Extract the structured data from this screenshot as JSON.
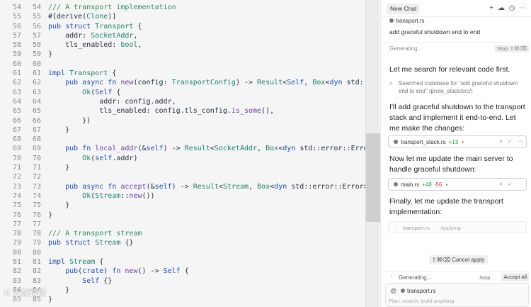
{
  "colors": {
    "comment": "#2f8f57",
    "keyword": "#1d4fb5",
    "type": "#18856f",
    "function": "#6b3fa0",
    "plain": "#1f2d3d",
    "added": "#2e9b4f",
    "removed": "#d24242"
  },
  "editor": {
    "line_numbers_left": [
      "54",
      "55",
      "56",
      "57",
      "58",
      "59",
      "60",
      "61",
      "62",
      "63",
      "64",
      "65",
      "66",
      "67",
      "68",
      "69",
      "70",
      "71",
      "72",
      "73",
      "74",
      "75",
      "76",
      "77",
      "78",
      "79",
      "80",
      "81",
      "82",
      "83",
      "84",
      "85"
    ],
    "line_numbers_right": [
      "54",
      "55",
      "56",
      "57",
      "58",
      "59",
      "60",
      "61",
      "62",
      "63",
      "64",
      "65",
      "66",
      "67",
      "68",
      "69",
      "70",
      "71",
      "72",
      "73",
      "74",
      "75",
      "76",
      "77",
      "78",
      "79",
      "80",
      "81",
      "82",
      "83",
      "84",
      "85"
    ],
    "lines": [
      [
        [
          "cm",
          "/// A transport implementation"
        ]
      ],
      [
        [
          "pl",
          "#[derive("
        ],
        [
          "ty",
          "Clone"
        ],
        [
          "pl",
          ")]"
        ]
      ],
      [
        [
          "kw",
          "pub struct "
        ],
        [
          "ty",
          "Transport"
        ],
        [
          "pl",
          " {"
        ]
      ],
      [
        [
          "pl",
          "    addr: "
        ],
        [
          "ty",
          "SocketAddr"
        ],
        [
          "pl",
          ","
        ]
      ],
      [
        [
          "pl",
          "    tls_enabled: "
        ],
        [
          "ty",
          "bool"
        ],
        [
          "pl",
          ","
        ]
      ],
      [
        [
          "pl",
          "}"
        ]
      ],
      [
        [
          "pl",
          ""
        ]
      ],
      [
        [
          "kw",
          "impl "
        ],
        [
          "ty",
          "Transport"
        ],
        [
          "pl",
          " {"
        ]
      ],
      [
        [
          "pl",
          "    "
        ],
        [
          "kw",
          "pub async fn "
        ],
        [
          "fn",
          "new"
        ],
        [
          "pl",
          "(config: "
        ],
        [
          "ty",
          "TransportConfig"
        ],
        [
          "pl",
          ") -> "
        ],
        [
          "ty",
          "Result"
        ],
        [
          "pl",
          "<"
        ],
        [
          "kw",
          "Self"
        ],
        [
          "pl",
          ", "
        ],
        [
          "ty",
          "Box"
        ],
        [
          "pl",
          "<"
        ],
        [
          "kw",
          "dyn "
        ],
        [
          "pl",
          "std::error::Error>> {"
        ]
      ],
      [
        [
          "pl",
          "        "
        ],
        [
          "ty",
          "Ok"
        ],
        [
          "pl",
          "("
        ],
        [
          "kw",
          "Self"
        ],
        [
          "pl",
          " {"
        ]
      ],
      [
        [
          "pl",
          "            addr: config.addr,"
        ]
      ],
      [
        [
          "pl",
          "            tls_enabled: config.tls_config."
        ],
        [
          "fn",
          "is_some"
        ],
        [
          "pl",
          "(),"
        ]
      ],
      [
        [
          "pl",
          "        })"
        ]
      ],
      [
        [
          "pl",
          "    }"
        ]
      ],
      [
        [
          "pl",
          ""
        ]
      ],
      [
        [
          "pl",
          "    "
        ],
        [
          "kw",
          "pub fn "
        ],
        [
          "fn",
          "local_addr"
        ],
        [
          "pl",
          "(&"
        ],
        [
          "kw",
          "self"
        ],
        [
          "pl",
          ") -> "
        ],
        [
          "ty",
          "Result"
        ],
        [
          "pl",
          "<"
        ],
        [
          "ty",
          "SocketAddr"
        ],
        [
          "pl",
          ", "
        ],
        [
          "ty",
          "Box"
        ],
        [
          "pl",
          "<"
        ],
        [
          "kw",
          "dyn "
        ],
        [
          "pl",
          "std::error::Error>> {"
        ]
      ],
      [
        [
          "pl",
          "        "
        ],
        [
          "ty",
          "Ok"
        ],
        [
          "pl",
          "("
        ],
        [
          "kw",
          "self"
        ],
        [
          "pl",
          ".addr)"
        ]
      ],
      [
        [
          "pl",
          "    }"
        ]
      ],
      [
        [
          "pl",
          ""
        ]
      ],
      [
        [
          "pl",
          "    "
        ],
        [
          "kw",
          "pub async fn "
        ],
        [
          "fn",
          "accept"
        ],
        [
          "pl",
          "(&"
        ],
        [
          "kw",
          "self"
        ],
        [
          "pl",
          ") -> "
        ],
        [
          "ty",
          "Result"
        ],
        [
          "pl",
          "<"
        ],
        [
          "ty",
          "Stream"
        ],
        [
          "pl",
          ", "
        ],
        [
          "ty",
          "Box"
        ],
        [
          "pl",
          "<"
        ],
        [
          "kw",
          "dyn "
        ],
        [
          "pl",
          "std::error::Error>> {"
        ]
      ],
      [
        [
          "pl",
          "        "
        ],
        [
          "ty",
          "Ok"
        ],
        [
          "pl",
          "("
        ],
        [
          "ty",
          "Stream"
        ],
        [
          "pl",
          "::"
        ],
        [
          "fn",
          "new"
        ],
        [
          "pl",
          "())"
        ]
      ],
      [
        [
          "pl",
          "    }"
        ]
      ],
      [
        [
          "pl",
          "}"
        ]
      ],
      [
        [
          "pl",
          ""
        ]
      ],
      [
        [
          "cm",
          "/// A transport stream"
        ]
      ],
      [
        [
          "kw",
          "pub struct "
        ],
        [
          "ty",
          "Stream"
        ],
        [
          "pl",
          " {}"
        ]
      ],
      [
        [
          "pl",
          ""
        ]
      ],
      [
        [
          "kw",
          "impl "
        ],
        [
          "ty",
          "Stream"
        ],
        [
          "pl",
          " {"
        ]
      ],
      [
        [
          "pl",
          "    "
        ],
        [
          "kw",
          "pub"
        ],
        [
          "pl",
          "("
        ],
        [
          "kw",
          "crate"
        ],
        [
          "pl",
          ") "
        ],
        [
          "kw",
          "fn "
        ],
        [
          "fn",
          "new"
        ],
        [
          "pl",
          "() -> "
        ],
        [
          "kw",
          "Self"
        ],
        [
          "pl",
          " {"
        ]
      ],
      [
        [
          "pl",
          "        "
        ],
        [
          "kw",
          "Self"
        ],
        [
          "pl",
          " {}"
        ]
      ],
      [
        [
          "pl",
          "    }"
        ]
      ],
      [
        [
          "pl",
          "}"
        ]
      ]
    ]
  },
  "watermark": "K 大叔跨境",
  "chat": {
    "tab_label": "New Chat",
    "icons": [
      "plus-icon",
      "cloud-icon",
      "history-icon",
      "more-icon"
    ],
    "icon_glyphs": {
      "plus": "+",
      "cloud": "☁",
      "history": "◷",
      "more": "⋯"
    },
    "context": {
      "file": "transport.rs",
      "message": "add graceful shutdown end to end"
    },
    "generating_top": {
      "text": "Generating...",
      "stop_label": "Stop ⇧⌘⌫"
    },
    "msg1": "Let me search for relevant code first.",
    "search_step": {
      "icon": "⌕",
      "text": "Searched codebase for \"add graceful shutdown end to end\" (proto_stack/src/)"
    },
    "msg2": "I'll add graceful shutdown to the transport stack and implement it end-to-end. Let me make the changes:",
    "card1": {
      "file": "transport_stack.rs",
      "added": "+13",
      "added_marker": "•",
      "close": "×",
      "check": "✓",
      "more": "⋯"
    },
    "msg3": "Now let me update the main server to handle graceful shutdown:",
    "card2": {
      "file": "main.rs",
      "added": "+48",
      "removed": "-56",
      "added_marker": "•",
      "close": "×",
      "check": "✓",
      "more": "⋯"
    },
    "msg4": "Finally, let me update the transport implementation:",
    "card3": {
      "spinner": "◌",
      "file": "transport.rs",
      "state": "Applying"
    },
    "cancel_apply": "⇧⌘⌫ Cancel apply",
    "generating_bottom": {
      "chevron": "›",
      "text": "Generating...",
      "stop_label": "Stop",
      "accept_label": "Accept all"
    },
    "input": {
      "at_icon": "@",
      "chip_file": "transport.rs",
      "placeholder": "Plan, search, build anything"
    }
  }
}
